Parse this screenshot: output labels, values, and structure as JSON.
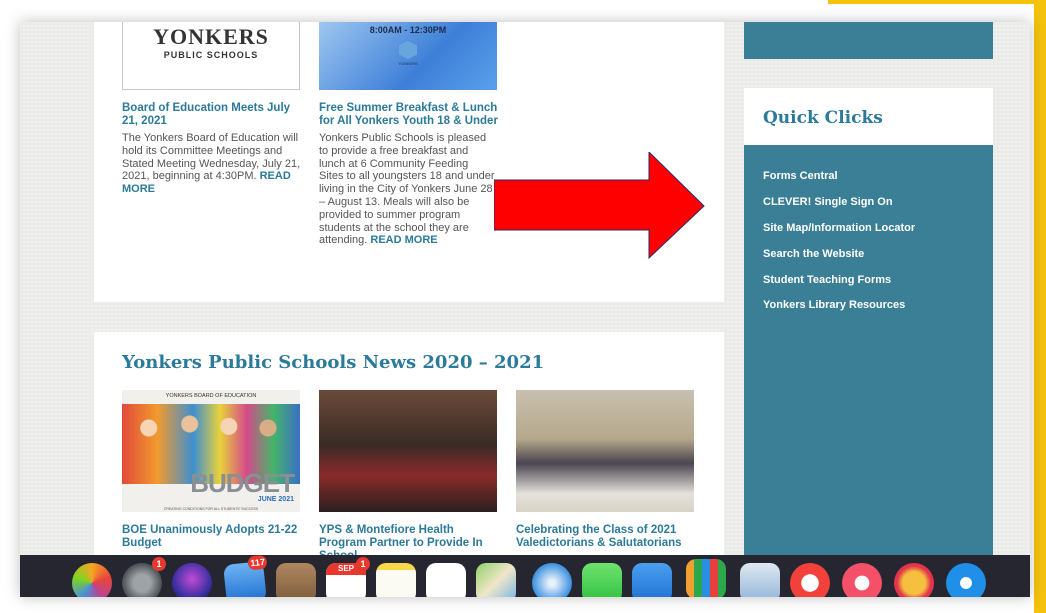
{
  "posts": [
    {
      "thumb": {
        "logo_main": "YONKERS",
        "logo_sub": "PUBLIC SCHOOLS"
      },
      "title": "Board of Education Meets July 21, 2021",
      "body": "The Yonkers Board of Education will hold its Committee Meetings and Stated Meeting Wednesday, July 21, 2021, beginning at 4:30PM.",
      "read_more": "READ MORE"
    },
    {
      "thumb": {
        "time": "8:00AM - 12:30PM",
        "sub": "YONKERS"
      },
      "title": "Free Summer Breakfast & Lunch for All Yonkers Youth 18 & Under",
      "body": "Yonkers Public Schools is pleased to provide a free breakfast and lunch at 6 Community Feeding Sites to all youngsters 18 and under living in the City of Yonkers June 28 – August 13. Meals will also be provided to summer program students at the school they are attending.",
      "read_more": "READ MORE"
    }
  ],
  "news": {
    "heading": "Yonkers Public Schools News 2020 – 2021",
    "items": [
      {
        "title": "BOE Unanimously Adopts 21-22 Budget",
        "image": {
          "header": "YONKERS BOARD OF EDUCATION",
          "word": "BUDGET",
          "date": "JUNE 2021",
          "tagline": "CREATING CONDITIONS FOR ALL STUDENTS' SUCCESS"
        }
      },
      {
        "title": "YPS & Montefiore Health Program Partner to Provide In School"
      },
      {
        "title": "Celebrating the Class of 2021 Valedictorians & Salutatorians"
      }
    ]
  },
  "quick_clicks": {
    "title": "Quick Clicks",
    "links": [
      "Forms Central",
      "CLEVER! Single Sign On",
      "Site Map/Information Locator",
      "Search the Website",
      "Student Teaching Forms",
      "Yonkers Library Resources"
    ]
  },
  "annotation": {
    "arrow_color": "#ff0000"
  },
  "colors": {
    "accent": "#2b7a99",
    "sidebar": "#3a7f96",
    "highlight_border": "#f4c20d"
  },
  "dock": {
    "items": [
      {
        "icon": "photos-icon",
        "badge": ""
      },
      {
        "icon": "system-preferences-icon",
        "badge": "1"
      },
      {
        "icon": "siri-icon",
        "badge": ""
      },
      {
        "icon": "mail-icon",
        "badge": "117"
      },
      {
        "icon": "notes-brown-icon",
        "badge": ""
      },
      {
        "icon": "calendar-icon",
        "badge": "1",
        "label": "SEP"
      },
      {
        "icon": "notes-icon",
        "badge": ""
      },
      {
        "icon": "reminders-icon",
        "badge": ""
      },
      {
        "icon": "maps-icon",
        "badge": ""
      },
      {
        "icon": "safari-icon",
        "badge": ""
      },
      {
        "icon": "facetime-icon",
        "badge": ""
      },
      {
        "icon": "keynote-icon",
        "badge": ""
      },
      {
        "icon": "numbers-icon",
        "badge": ""
      },
      {
        "icon": "preview-icon",
        "badge": ""
      },
      {
        "icon": "news-icon",
        "badge": ""
      },
      {
        "icon": "music-icon",
        "badge": ""
      },
      {
        "icon": "photo-booth-icon",
        "badge": ""
      },
      {
        "icon": "xcode-icon",
        "badge": ""
      }
    ]
  }
}
